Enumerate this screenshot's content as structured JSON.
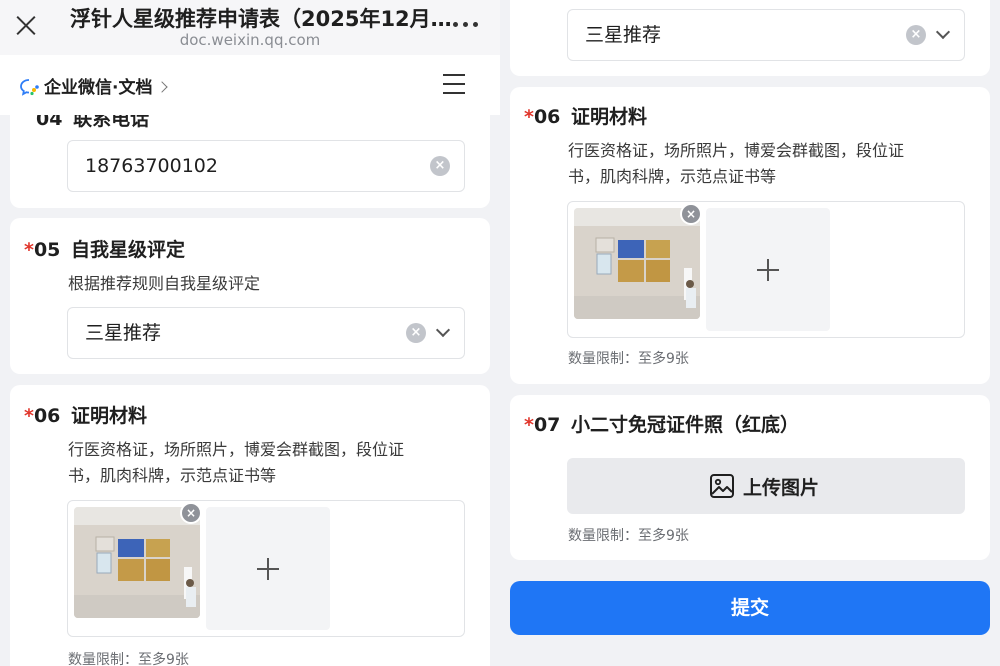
{
  "header": {
    "title": "浮针人星级推荐申请表（2025年12月…",
    "url": "doc.weixin.qq.com",
    "brand": "企业微信·文档"
  },
  "left": {
    "q04": {
      "number": "04",
      "title": "联系电话",
      "value": "18763700102"
    },
    "q05": {
      "required_mark": "*",
      "number": "05",
      "title": "自我星级评定",
      "description": "根据推荐规则自我星级评定",
      "value": "三星推荐"
    },
    "q06": {
      "required_mark": "*",
      "number": "06",
      "title": "证明材料",
      "description_line1": "行医资格证，场所照片，博爱会群截图，段位证",
      "description_line2": "书，肌肉科牌，示范点证书等",
      "limit": "数量限制：至多9张"
    }
  },
  "right": {
    "q05_value": "三星推荐",
    "q06": {
      "required_mark": "*",
      "number": "06",
      "title": "证明材料",
      "description_line1": "行医资格证，场所照片，博爱会群截图，段位证",
      "description_line2": "书，肌肉科牌，示范点证书等",
      "limit": "数量限制：至多9张"
    },
    "q07": {
      "required_mark": "*",
      "number": "07",
      "title": "小二寸免冠证件照（红底）",
      "upload_label": "上传图片",
      "limit": "数量限制：至多9张"
    },
    "submit_label": "提交"
  },
  "colors": {
    "accent": "#1f76f5",
    "required": "#e0352b",
    "background": "#f1f2f5"
  },
  "icons": {
    "close": "close-icon",
    "more": "more-icon",
    "brand": "wecom-chat-icon",
    "menu": "menu-icon",
    "clear": "clear-icon",
    "chevron": "chevron-down-icon",
    "add": "plus-icon",
    "image": "image-icon"
  }
}
